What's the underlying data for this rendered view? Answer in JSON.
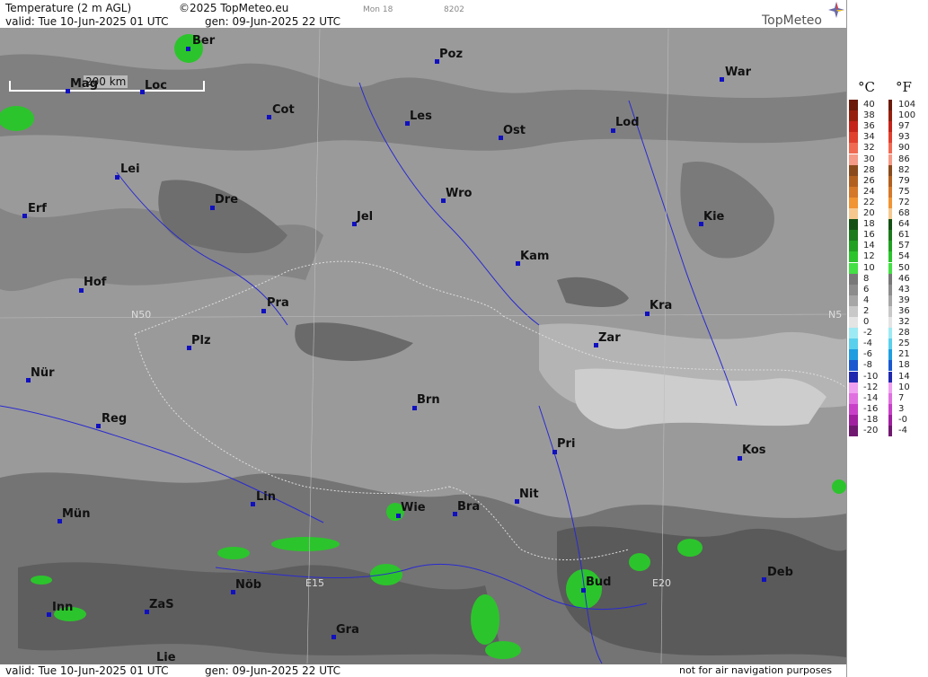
{
  "header": {
    "product": "Temperature (2 m AGL)",
    "copyright": "©2025 TopMeteo.eu",
    "day_mark": "Mon 18",
    "code": "8202",
    "valid": "valid:  Tue  10-Jun-2025  01 UTC",
    "gen": "gen:  09-Jun-2025 22 UTC",
    "logo": "TopMeteo"
  },
  "footer": {
    "valid": "valid:  Tue  10-Jun-2025  01 UTC",
    "gen": "gen:  09-Jun-2025 22 UTC",
    "disclaimer": "not for air navigation purposes"
  },
  "map": {
    "scale_label": "200 km",
    "grid_labels": [
      "N50",
      "N5",
      "E15",
      "E20"
    ],
    "cities": [
      {
        "name": "Ber"
      },
      {
        "name": "Poz"
      },
      {
        "name": "War"
      },
      {
        "name": "Mag"
      },
      {
        "name": "Loc"
      },
      {
        "name": "Cot"
      },
      {
        "name": "Les"
      },
      {
        "name": "Ost"
      },
      {
        "name": "Lod"
      },
      {
        "name": "Lei"
      },
      {
        "name": "Erf"
      },
      {
        "name": "Dre"
      },
      {
        "name": "Wro"
      },
      {
        "name": "Jel"
      },
      {
        "name": "Kie"
      },
      {
        "name": "Kam"
      },
      {
        "name": "Hof"
      },
      {
        "name": "Pra"
      },
      {
        "name": "Kra"
      },
      {
        "name": "Zar"
      },
      {
        "name": "Plz"
      },
      {
        "name": "Nür"
      },
      {
        "name": "Brn"
      },
      {
        "name": "Reg"
      },
      {
        "name": "Pri"
      },
      {
        "name": "Kos"
      },
      {
        "name": "Lin"
      },
      {
        "name": "Nit"
      },
      {
        "name": "Wie"
      },
      {
        "name": "Bra"
      },
      {
        "name": "Mün"
      },
      {
        "name": "Nöb"
      },
      {
        "name": "Bud"
      },
      {
        "name": "Deb"
      },
      {
        "name": "Inn"
      },
      {
        "name": "ZaS"
      },
      {
        "name": "Gra"
      },
      {
        "name": "Lie"
      }
    ]
  },
  "legend": {
    "unit_c": "°C",
    "unit_f": "°F",
    "celsius": [
      "40",
      "38",
      "36",
      "34",
      "32",
      "30",
      "28",
      "26",
      "24",
      "22",
      "20",
      "18",
      "16",
      "14",
      "12",
      "10",
      "8",
      "6",
      "4",
      "2",
      "0",
      "-2",
      "-4",
      "-6",
      "-8",
      "-10",
      "-12",
      "-14",
      "-16",
      "-18",
      "-20"
    ],
    "fahrenheit": [
      "104",
      "100",
      "97",
      "93",
      "90",
      "86",
      "82",
      "79",
      "75",
      "72",
      "68",
      "64",
      "61",
      "57",
      "54",
      "50",
      "46",
      "43",
      "39",
      "36",
      "32",
      "28",
      "25",
      "21",
      "18",
      "14",
      "10",
      "7",
      "3",
      "-0",
      "-4"
    ],
    "colors": [
      "#6b1a0a",
      "#96200e",
      "#c4241a",
      "#e0402e",
      "#f06a52",
      "#f49a86",
      "#8a4a1c",
      "#b26020",
      "#d4782a",
      "#f09434",
      "#f6c890",
      "#145014",
      "#1c7a1c",
      "#22a022",
      "#2cc42c",
      "#44e044",
      "#787878",
      "#8c8c8c",
      "#a6a6a6",
      "#c8c8c8",
      "#e4e4e4",
      "#9eeaf4",
      "#5ad0ec",
      "#1e9ee0",
      "#1a58d0",
      "#2028b0",
      "#f0a0f0",
      "#e070e0",
      "#c840c8",
      "#a020a0",
      "#701870"
    ]
  }
}
